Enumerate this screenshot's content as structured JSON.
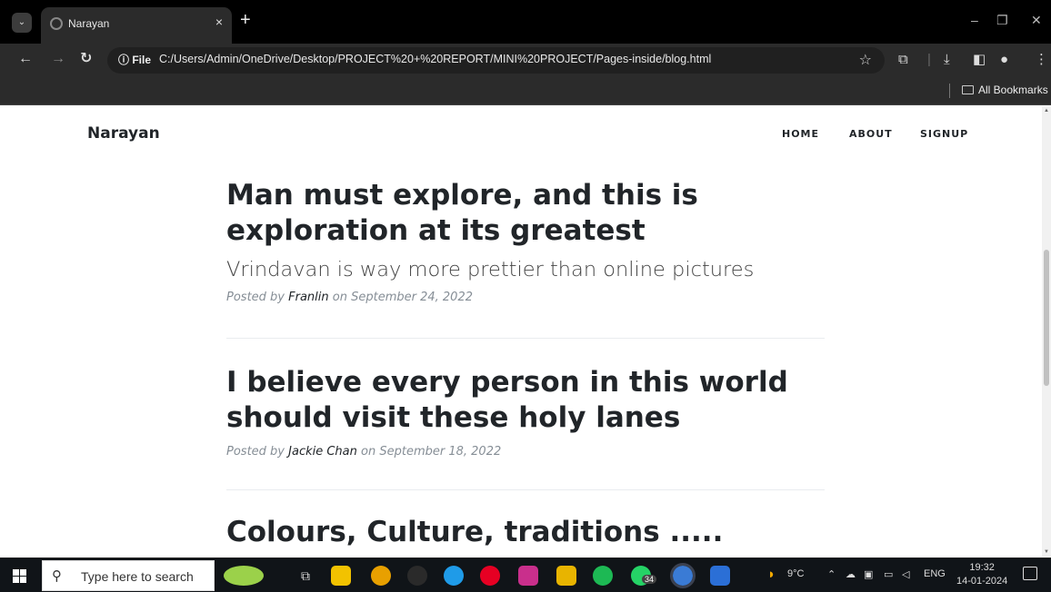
{
  "browser": {
    "tab_title": "Narayan",
    "tab_close": "×",
    "new_tab": "+",
    "window_controls": [
      "–",
      "❐",
      "✕"
    ],
    "omnibox_chip": "ⓘ File",
    "url": "C:/Users/Admin/OneDrive/Desktop/PROJECT%20+%20REPORT/MINI%20PROJECT/Pages-inside/blog.html",
    "bookmarks_label": "All Bookmarks"
  },
  "site": {
    "brand": "Narayan",
    "nav": [
      "HOME",
      "ABOUT",
      "SIGNUP"
    ]
  },
  "posts": [
    {
      "title": "Man must explore, and this is exploration at its greatest",
      "subtitle": "Vrindavan is way more prettier than online pictures",
      "posted_by": "Posted by",
      "author": "Franlin",
      "date": "on September 24, 2022"
    },
    {
      "title": "I believe every person in this world should visit these holy lanes",
      "posted_by": "Posted by",
      "author": "Jackie Chan",
      "date": "on September 18, 2022"
    },
    {
      "title": "Colours, Culture, traditions ....."
    }
  ],
  "taskbar": {
    "search_placeholder": "Type here to search",
    "weather": "9°C",
    "language": "ENG",
    "time": "19:32",
    "date": "14-01-2024",
    "whatsapp_badge": "34"
  }
}
